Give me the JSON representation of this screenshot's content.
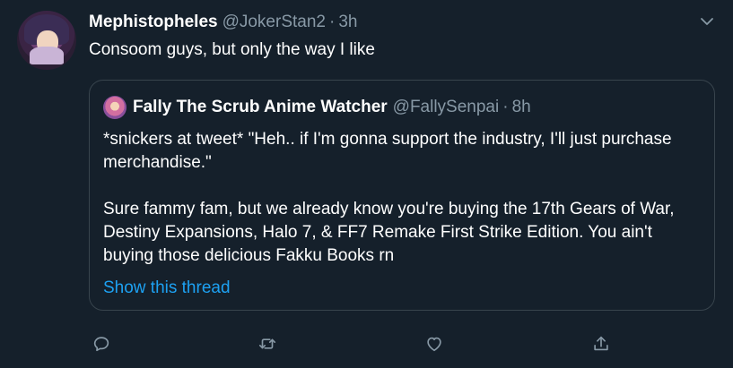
{
  "tweet": {
    "display_name": "Mephistopheles",
    "handle": "@JokerStan2",
    "separator": "·",
    "time": "3h",
    "text": "Consoom guys, but only the way I like"
  },
  "quoted": {
    "display_name": "Fally The Scrub Anime Watcher",
    "handle": "@FallySenpai",
    "separator": "·",
    "time": "8h",
    "paragraphs": [
      "*snickers at tweet* \"Heh.. if I'm gonna support the industry, I'll just purchase merchandise.\"",
      "Sure fammy fam, but we already know you're buying the 17th Gears of War, Destiny Expansions, Halo 7, & FF7 Remake First Strike Edition. You ain't buying those delicious Fakku Books rn"
    ],
    "show_thread": "Show this thread"
  },
  "icons": {
    "more": "chevron-down-icon",
    "reply": "reply-icon",
    "retweet": "retweet-icon",
    "like": "heart-icon",
    "share": "share-icon"
  },
  "colors": {
    "background": "#15202b",
    "secondary_text": "#8899a6",
    "link": "#1da1f2",
    "border": "#38444d"
  }
}
